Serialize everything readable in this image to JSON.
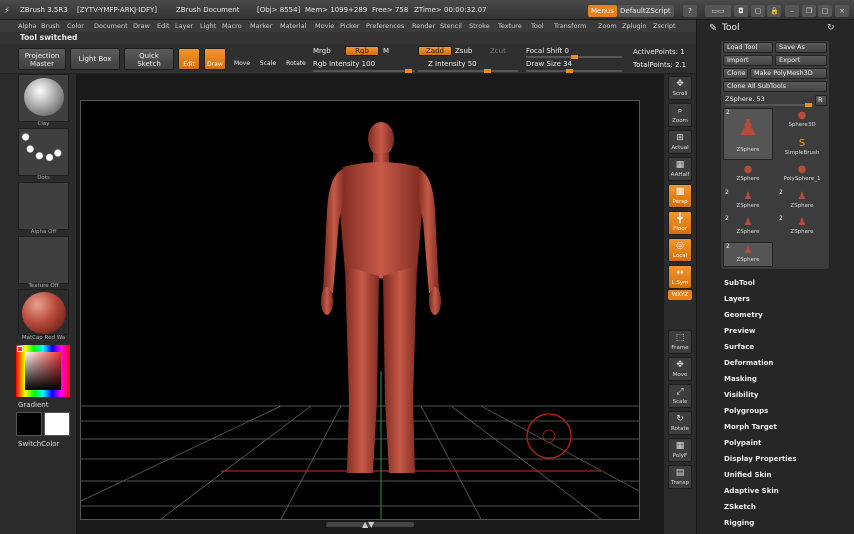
{
  "titlebar": {
    "app": "ZBrush 3.5R3",
    "serial": "[ZYTV-YMFP-ARKJ-IDFY]",
    "doc": "ZBrush Document",
    "obj": "[Obj> 8554]",
    "mem": "Mem> 1099+289",
    "free": "Free> 758",
    "ztime": "ZTime> 00:00:32.07",
    "menus": "Menus",
    "script": "DefaultZScript"
  },
  "menus": [
    "Alpha",
    "Brush",
    "Color",
    "Document",
    "Draw",
    "Edit",
    "Layer",
    "Light",
    "Macro",
    "Marker",
    "Material",
    "Movie",
    "Picker",
    "Preferences",
    "Render",
    "Stencil",
    "Stroke",
    "Texture",
    "Tool",
    "Transform",
    "Zoom",
    "Zplugin",
    "Zscript"
  ],
  "note": "Tool switched",
  "toolbar": {
    "projection": "Projection",
    "master": "Master",
    "lightbox": "Light Box",
    "quick": "Quick",
    "sketch": "Sketch",
    "edit": "Edit",
    "draw": "Draw",
    "move": "Move",
    "scale": "Scale",
    "rotate": "Rotate",
    "mrgb": "Mrgb",
    "rgb": "Rgb",
    "m": "M",
    "zadd": "Zadd",
    "zsub": "Zsub",
    "zcut": "Zcut",
    "focal": "Focal Shift 0",
    "rgbint": "Rgb Intensity 100",
    "zint": "Z Intensity 50",
    "drawsize": "Draw Size 34",
    "active": "ActivePoints: 1",
    "total": "TotalPoints: 2.1"
  },
  "left": {
    "clay": "Clay",
    "dots": "Dots",
    "alpha": "Alpha Off",
    "texture": "Texture Off",
    "matcap": "MatCap Red Wa",
    "gradient": "Gradient",
    "switch": "SwitchColor"
  },
  "rightshelf": [
    {
      "n": "scroll",
      "l": "Scroll",
      "o": false
    },
    {
      "n": "zoom",
      "l": "Zoom",
      "o": false
    },
    {
      "n": "actual",
      "l": "Actual",
      "o": false
    },
    {
      "n": "aahalf",
      "l": "AAHalf",
      "o": false
    },
    {
      "n": "persp",
      "l": "Persp",
      "o": true
    },
    {
      "n": "floor",
      "l": "Floor",
      "o": true
    },
    {
      "n": "local",
      "l": "Local",
      "o": true
    },
    {
      "n": "lsym",
      "l": "L.Sym",
      "o": true
    },
    {
      "n": "frame",
      "l": "Frame",
      "o": false
    },
    {
      "n": "move",
      "l": "Move",
      "o": false
    },
    {
      "n": "scale",
      "l": "Scale",
      "o": false
    },
    {
      "n": "rotate",
      "l": "Rotate",
      "o": false
    },
    {
      "n": "polyf",
      "l": "PolyF",
      "o": false
    },
    {
      "n": "transp",
      "l": "Transp",
      "o": false
    }
  ],
  "xyz": "WXYZ",
  "tool": {
    "title": "Tool",
    "load": "Load Tool",
    "save": "Save As",
    "import": "Import",
    "export": "Export",
    "clone": "Clone",
    "polymesh": "Make PolyMesh3D",
    "cloneall": "Clone All SubTools",
    "current": "ZSphere. 53",
    "r": "R",
    "items": [
      {
        "n": "2",
        "l": "ZSphere"
      },
      {
        "n": "",
        "l": "Sphere3D"
      },
      {
        "n": "",
        "l": "SimpleBrush"
      },
      {
        "n": "",
        "l": "ZSphere"
      },
      {
        "n": "",
        "l": "PolySphere_1"
      },
      {
        "n": "2",
        "l": "ZSphere"
      },
      {
        "n": "2",
        "l": "ZSphere"
      },
      {
        "n": "2",
        "l": "ZSphere"
      },
      {
        "n": "2",
        "l": "ZSphere"
      },
      {
        "n": "2",
        "l": "ZSphere"
      }
    ]
  },
  "sections": [
    "SubTool",
    "Layers",
    "Geometry",
    "Preview",
    "Surface",
    "Deformation",
    "Masking",
    "Visibility",
    "Polygroups",
    "Morph Target",
    "Polypaint",
    "Display Properties",
    "Unified Skin",
    "Adaptive Skin",
    "ZSketch",
    "Rigging"
  ],
  "colors": {
    "accent": "#f08a18",
    "model": "#b84a3a"
  }
}
